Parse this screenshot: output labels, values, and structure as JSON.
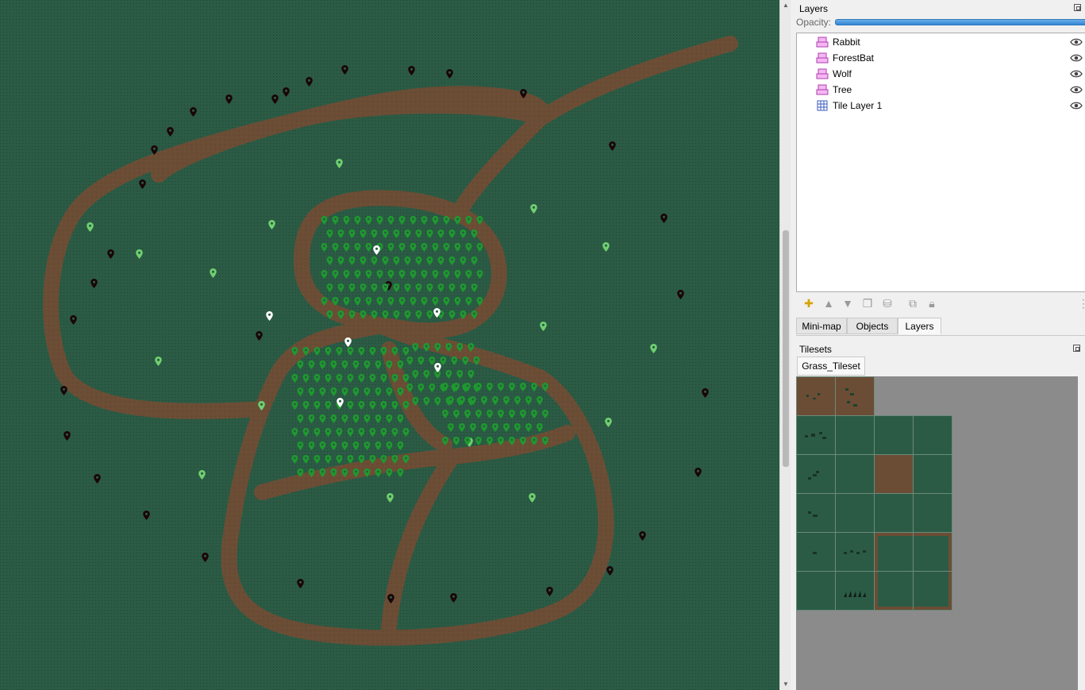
{
  "layers_panel": {
    "title": "Layers",
    "opacity_label": "Opacity:",
    "opacity_value": 1.0,
    "layers": [
      {
        "name": "Rabbit",
        "type": "object-layer",
        "visible": true
      },
      {
        "name": "ForestBat",
        "type": "object-layer",
        "visible": true
      },
      {
        "name": "Wolf",
        "type": "object-layer",
        "visible": true
      },
      {
        "name": "Tree",
        "type": "object-layer",
        "visible": true
      },
      {
        "name": "Tile Layer 1",
        "type": "tile-layer",
        "visible": true
      }
    ],
    "toolbar_icons": [
      "new-layer-icon",
      "raise-layer-icon",
      "lower-layer-icon",
      "duplicate-layer-icon",
      "delete-layer-icon",
      "merge-layer-icon",
      "lock-icon"
    ]
  },
  "dock_tabs": [
    {
      "label": "Mini-map",
      "active": false
    },
    {
      "label": "Objects",
      "active": false
    },
    {
      "label": "Layers",
      "active": true
    }
  ],
  "tilesets_panel": {
    "title": "Tilesets",
    "active_tileset": "Grass_Tileset"
  },
  "colors": {
    "grass": "#2b5b45",
    "path": "#6b4d35",
    "rabbit_marker": "#3aa83a",
    "wolf_marker": "#5a0f18",
    "tree_marker": "#1e8a2e",
    "bat_marker": "#ffffff",
    "slider": "#2f86d3"
  }
}
